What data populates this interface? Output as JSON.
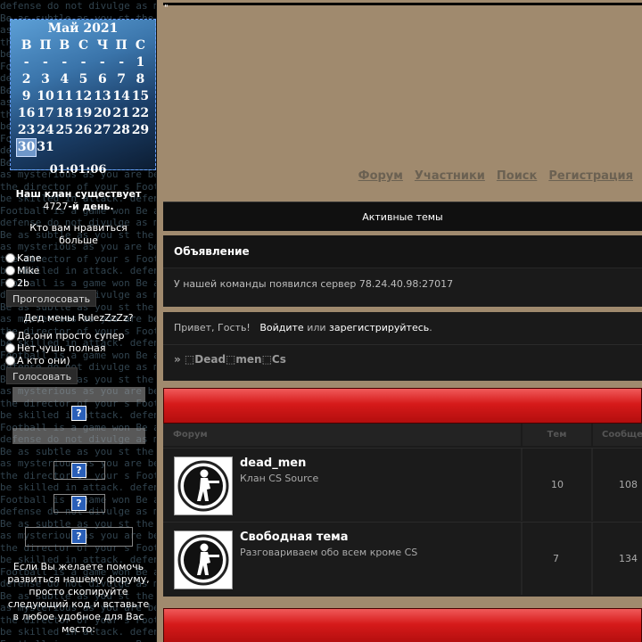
{
  "sidebar": {
    "calendar": {
      "title": "Май 2021",
      "weekdays": [
        "В",
        "П",
        "В",
        "С",
        "Ч",
        "П",
        "С"
      ],
      "weeks": [
        [
          "-",
          "-",
          "-",
          "-",
          "-",
          "-",
          "1"
        ],
        [
          "2",
          "3",
          "4",
          "5",
          "6",
          "7",
          "8"
        ],
        [
          "9",
          "10",
          "11",
          "12",
          "13",
          "14",
          "15"
        ],
        [
          "16",
          "17",
          "18",
          "19",
          "20",
          "21",
          "22"
        ],
        [
          "23",
          "24",
          "25",
          "26",
          "27",
          "28",
          "29"
        ],
        [
          "30",
          "31",
          "",
          "",
          "",
          "",
          ""
        ]
      ],
      "today": "30",
      "time": "01:01:06"
    },
    "clan_line1": "Наш клан существует",
    "clan_days": "4727",
    "clan_suffix": "-й день.",
    "poll1": {
      "question": "Кто вам нравиться больше",
      "options": [
        "Kane",
        "Mike",
        "2b"
      ],
      "button": "Проголосовать"
    },
    "poll2": {
      "question": "Дед мены RulezZzZz?",
      "options": [
        "Да,они просто супер",
        "Нет,чушь полная",
        "А кто они)"
      ],
      "button": "Голосовать"
    },
    "help_text": "Если Вы желаете помочь развиться нашему форуму, просто скопируйте следующий код и вставьте в любое удобное для Вас место:"
  },
  "header": {
    "quote_mark": "\"",
    "nav": [
      "Форум",
      "Участники",
      "Поиск",
      "Регистрация"
    ]
  },
  "active_topics": "Активные темы",
  "announcement": {
    "title": "Объявление",
    "text": "У нашей команды появился сервер 78.24.40.98:27017"
  },
  "greeting": {
    "hello": "Привет, Гость!",
    "login": "Войдите",
    "or": "или",
    "register": "зарегистрируйтесь",
    "dot": ".",
    "breadcrumb": "» ⬚Dead⬚men⬚Cs"
  },
  "forum_table": {
    "headers": [
      "Форум",
      "Тем",
      "Сообще"
    ],
    "rows": [
      {
        "name": "dead_men",
        "desc": "Клан CS Source",
        "topics": "10",
        "posts": "108"
      },
      {
        "name": "Свободная тема",
        "desc": "Разговариваем обо всем кроме CS",
        "topics": "7",
        "posts": "134"
      }
    ]
  },
  "colors": {
    "accent_red": "#d61a1a",
    "nav_link": "#6b6152",
    "page_bg": "#a08a6e"
  }
}
